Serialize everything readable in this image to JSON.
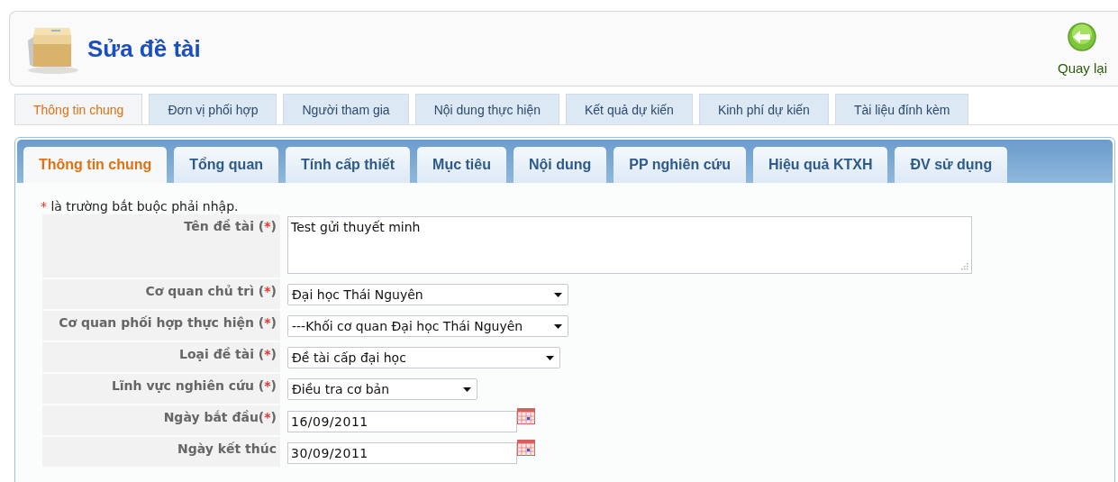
{
  "header": {
    "title": "Sửa đề tài",
    "back_label": "Quay lại"
  },
  "top_tabs": [
    {
      "label": "Thông tin chung",
      "selected": true
    },
    {
      "label": "Đơn vị phối hợp",
      "selected": false
    },
    {
      "label": "Người tham gia",
      "selected": false
    },
    {
      "label": "Nội dung thực hiện",
      "selected": false
    },
    {
      "label": "Kết quả dự kiến",
      "selected": false
    },
    {
      "label": "Kinh phí dự kiến",
      "selected": false
    },
    {
      "label": "Tài liệu đính kèm",
      "selected": false
    }
  ],
  "inner_tabs": [
    {
      "label": "Thông tin chung",
      "selected": true
    },
    {
      "label": "Tổng quan",
      "selected": false
    },
    {
      "label": "Tính cấp thiết",
      "selected": false
    },
    {
      "label": "Mục tiêu",
      "selected": false
    },
    {
      "label": "Nội dung",
      "selected": false
    },
    {
      "label": "PP nghiên cứu",
      "selected": false
    },
    {
      "label": "Hiệu quả KTXH",
      "selected": false
    },
    {
      "label": "ĐV sử dụng",
      "selected": false
    }
  ],
  "note": {
    "mark": "*",
    "text": " là trường bắt buộc phải nhập."
  },
  "fields": [
    {
      "kind": "textarea",
      "label": "Tên đề tài (",
      "required_mark": "*",
      "label_close": ")",
      "value": "Test gửi thuyết minh"
    },
    {
      "kind": "select",
      "label": "Cơ quan chủ trì (",
      "required_mark": "*",
      "label_close": ")",
      "value": "Đại học Thái Nguyên"
    },
    {
      "kind": "select",
      "label": "Cơ quan phối hợp thực hiện (",
      "required_mark": "*",
      "label_close": ")",
      "value": "---Khối cơ quan Đại học Thái Nguyên"
    },
    {
      "kind": "select",
      "label": "Loại đề tài (",
      "required_mark": "*",
      "label_close": ")",
      "value": "Đề tài cấp đại học"
    },
    {
      "kind": "select",
      "label": "Lĩnh vực nghiên cứu (",
      "required_mark": "*",
      "label_close": ")",
      "value": "Điều tra cơ bản"
    },
    {
      "kind": "date",
      "label": "Ngày bắt đầu(",
      "required_mark": "*",
      "label_close": ")",
      "value": "16/09/2011"
    },
    {
      "kind": "date",
      "label": "Ngày kết thúc",
      "value": "30/09/2011"
    }
  ]
}
